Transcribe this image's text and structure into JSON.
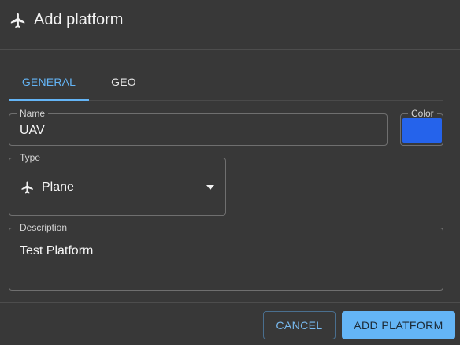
{
  "dialog": {
    "title": "Add platform",
    "title_icon": "plane-icon"
  },
  "tabs": [
    {
      "label": "GENERAL",
      "active": true
    },
    {
      "label": "GEO",
      "active": false
    }
  ],
  "form": {
    "name": {
      "label": "Name",
      "value": "UAV"
    },
    "color": {
      "label": "Color",
      "value": "#2563eb"
    },
    "type": {
      "label": "Type",
      "value": "Plane",
      "icon": "plane-icon"
    },
    "description": {
      "label": "Description",
      "value": "Test Platform"
    }
  },
  "actions": {
    "cancel_label": "CANCEL",
    "add_label": "ADD PLATFORM"
  },
  "colors": {
    "accent": "#64b5f6",
    "background": "#383838",
    "selected_color": "#2563eb"
  }
}
